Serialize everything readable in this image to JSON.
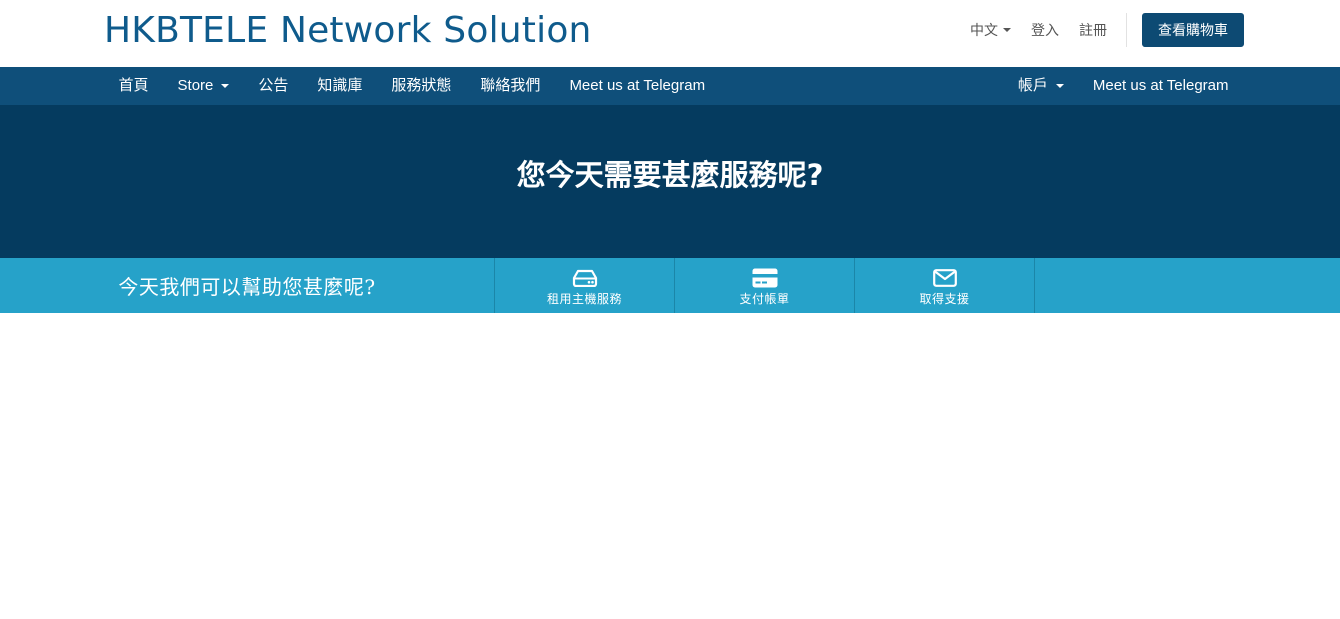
{
  "header": {
    "brand": "HKBTELE Network Solution",
    "language": "中文",
    "login": "登入",
    "register": "註冊",
    "cart": "查看購物車"
  },
  "nav": {
    "left": [
      {
        "label": "首頁",
        "dropdown": false
      },
      {
        "label": "Store",
        "dropdown": true
      },
      {
        "label": "公告",
        "dropdown": false
      },
      {
        "label": "知識庫",
        "dropdown": false
      },
      {
        "label": "服務狀態",
        "dropdown": false
      },
      {
        "label": "聯絡我們",
        "dropdown": false
      },
      {
        "label": "Meet us at Telegram",
        "dropdown": false
      }
    ],
    "right": [
      {
        "label": "帳戶",
        "dropdown": true
      },
      {
        "label": "Meet us at Telegram",
        "dropdown": false
      }
    ]
  },
  "hero": {
    "heading": "您今天需要甚麼服務呢?"
  },
  "helpbar": {
    "title": "今天我們可以幫助您甚麼呢?",
    "items": [
      {
        "label": "租用主機服務",
        "icon": "server-icon"
      },
      {
        "label": "支付帳單",
        "icon": "credit-card-icon"
      },
      {
        "label": "取得支援",
        "icon": "envelope-icon"
      }
    ]
  },
  "colors": {
    "brand_text": "#0f5b8c",
    "navbar": "#0f4f7a",
    "hero": "#053b5f",
    "helpbar": "#26a2c9",
    "cart_button": "#0d4a73"
  }
}
